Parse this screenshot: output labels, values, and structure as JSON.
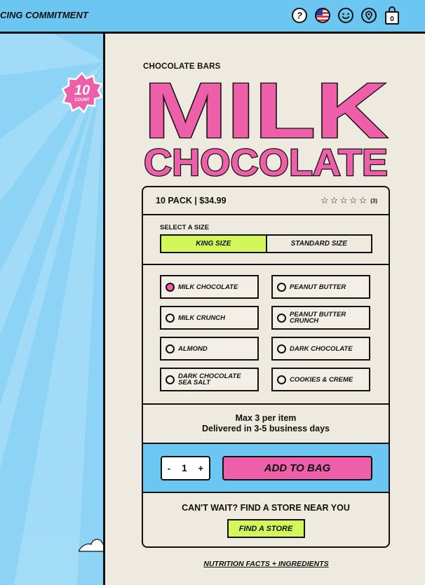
{
  "header": {
    "promo_text": "CING COMMITMENT",
    "icons": [
      "help-icon",
      "us-flag-icon",
      "smiley-icon",
      "location-icon",
      "bag-icon"
    ],
    "bag_count": "0"
  },
  "badge": {
    "number": "10",
    "label": "COUNT"
  },
  "product": {
    "subtitle": "CHOCOLATE BARS",
    "title_line1": "MILK",
    "title_line2": "CHOCOLATE",
    "price_label": "10 PACK | $34.99",
    "rating": {
      "stars": 5,
      "filled": 0,
      "count": "(3)"
    }
  },
  "size": {
    "label": "SELECT A SIZE",
    "options": [
      {
        "label": "KING SIZE",
        "selected": true
      },
      {
        "label": "STANDARD SIZE",
        "selected": false
      }
    ]
  },
  "flavors": [
    {
      "line1": "MILK CHOCOLATE",
      "line2": "",
      "selected": true
    },
    {
      "line1": "PEANUT BUTTER",
      "line2": "",
      "selected": false
    },
    {
      "line1": "MILK CRUNCH",
      "line2": "",
      "selected": false
    },
    {
      "line1": "PEANUT BUTTER",
      "line2": "CRUNCH",
      "selected": false
    },
    {
      "line1": "ALMOND",
      "line2": "",
      "selected": false
    },
    {
      "line1": "DARK CHOCOLATE",
      "line2": "",
      "selected": false
    },
    {
      "line1": "DARK CHOCOLATE",
      "line2": "SEA SALT",
      "selected": false
    },
    {
      "line1": "COOKIES & CREME",
      "line2": "",
      "selected": false
    }
  ],
  "info": {
    "line1": "Max 3 per item",
    "line2": "Delivered in 3-5 business days"
  },
  "cart": {
    "minus": "-",
    "quantity": "1",
    "plus": "+",
    "add_label": "ADD TO BAG"
  },
  "store": {
    "question": "CAN'T WAIT? FIND A STORE NEAR YOU",
    "button": "FIND A STORE"
  },
  "footer": {
    "nutrition_link": "NUTRITION FACTS + INGREDIENTS"
  },
  "colors": {
    "sky": "#6cc6f2",
    "pink": "#ee5fa9",
    "lime": "#d3f65a",
    "cream": "#efeae0",
    "ink": "#111111"
  }
}
